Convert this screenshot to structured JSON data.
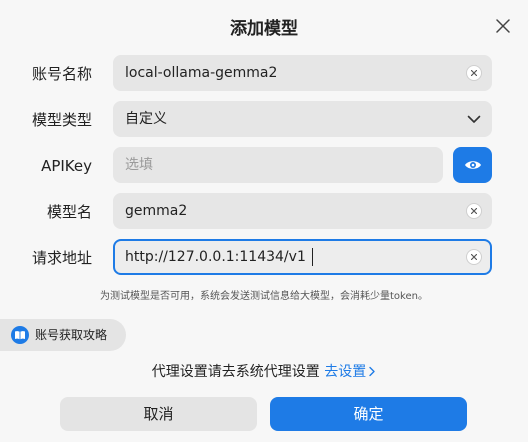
{
  "dialog": {
    "title": "添加模型",
    "account_name": {
      "label": "账号名称",
      "value": "local-ollama-gemma2"
    },
    "model_type": {
      "label": "模型类型",
      "value": "自定义"
    },
    "api_key": {
      "label": "APIKey",
      "placeholder": "选填",
      "value": ""
    },
    "model_name": {
      "label": "模型名",
      "value": "gemma2"
    },
    "request_url": {
      "label": "请求地址",
      "value": "http://127.0.0.1:11434/v1"
    },
    "hint": "为测试模型是否可用，系统会发送测试信息给大模型，会消耗少量token。",
    "guide_label": "账号获取攻略",
    "proxy_text": "代理设置请去系统代理设置",
    "proxy_link": "去设置",
    "cancel_label": "取消",
    "confirm_label": "确定"
  },
  "colors": {
    "accent": "#1e7be6",
    "field_bg": "#e6e6e6",
    "dialog_bg": "#f7f7f7"
  }
}
